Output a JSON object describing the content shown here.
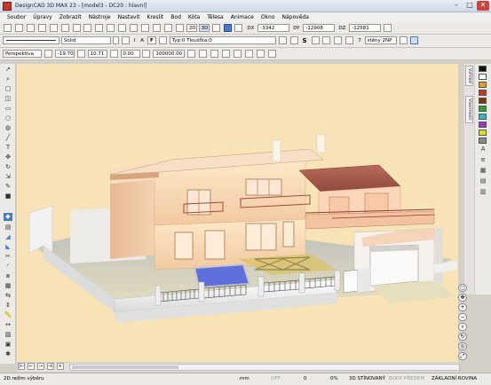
{
  "window": {
    "title": "DesignCAD 3D MAX 23 - [model3 - DC20 : hlavní]",
    "minimize": "–",
    "maximize": "□",
    "close": "✕"
  },
  "menu": [
    "Soubor",
    "Úpravy",
    "Zobrazit",
    "Nástroje",
    "Nastavit",
    "Kreslit",
    "Bod",
    "Kóta",
    "Tělesa",
    "Animace",
    "Okno",
    "Nápověda"
  ],
  "toolbar1": {
    "view_2d": "2D",
    "view_3d": "3D",
    "dx_label": "DX",
    "dx_value": "-3342",
    "dy_label": "DY",
    "dy_value": "-12908",
    "dz_label": "DZ",
    "dz_value": "-12581"
  },
  "toolbar2": {
    "line_style": "Solid",
    "italic": "I",
    "text_a": "A",
    "font_f": "F",
    "font_type": "Typ:0  Tloušťka:0",
    "symbol_s": "S",
    "steny_count": "7",
    "steny_label": "stěny 2NP"
  },
  "toolbar3": {
    "projection": "Perspektiva",
    "val1": "-19.70",
    "val2": "10.71",
    "val3": "0.00",
    "val4": "100000.00"
  },
  "right_tabs": [
    "Vzhled",
    "Vlastnosti"
  ],
  "palette_colors": [
    "#111111",
    "#ffffff",
    "#e8a020",
    "#c0392b",
    "#7a3a10",
    "#2e9e3a",
    "#34b8b8",
    "#9b3ab8",
    "#dcdc2a",
    "#8a8a8a"
  ],
  "page_tabs": [
    "|←",
    "←",
    "→",
    "→|",
    "+"
  ],
  "status": {
    "mode": "2D režim výběru",
    "unit": "mm",
    "off": "OFF",
    "zero": "0",
    "percent": "0%",
    "shading": "3D STÍNOVANÝ",
    "view_front": "BODY PŘEDEM",
    "plane": "ZÁKLADNÍ ROVINA"
  },
  "colors": {
    "viewport_bg": "#f7e3b6",
    "accent_blue": "#4a78c4"
  }
}
